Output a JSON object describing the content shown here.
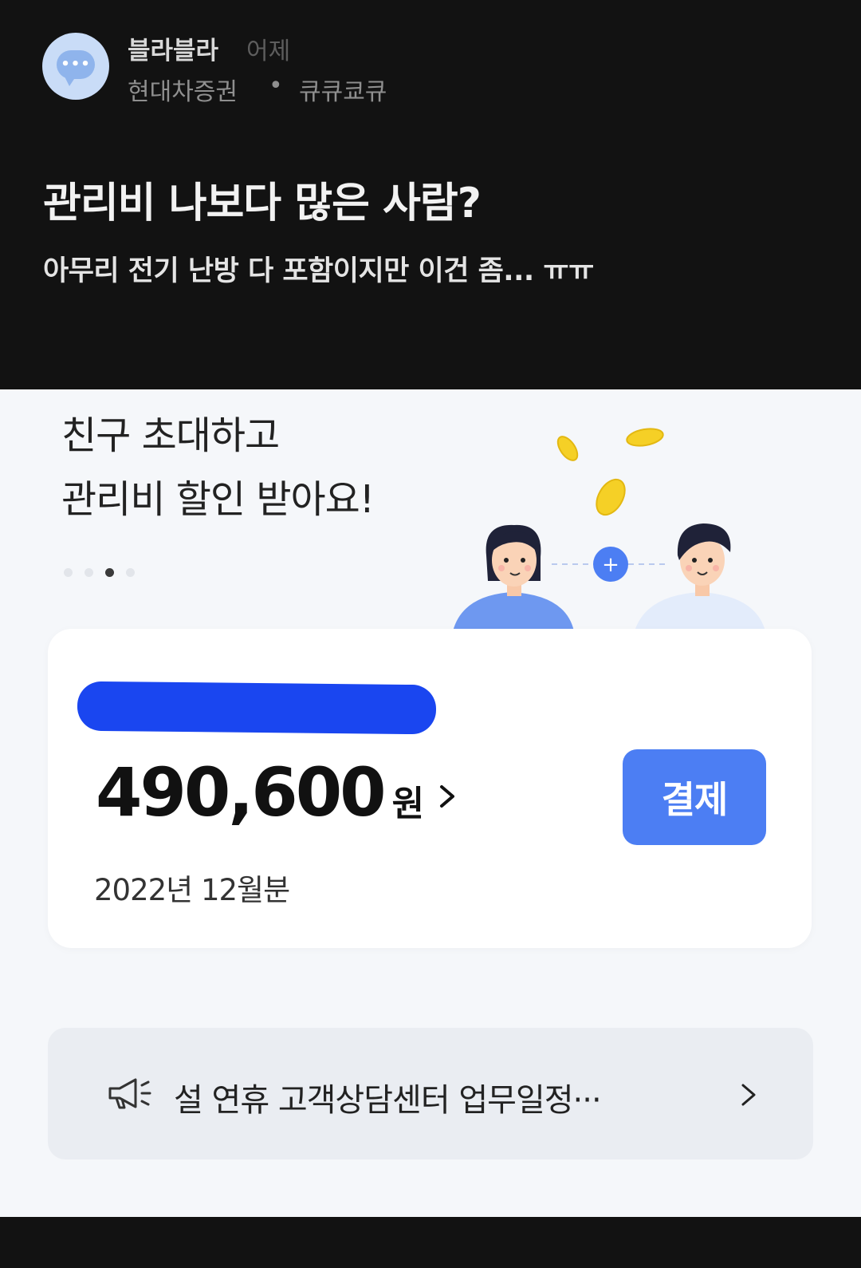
{
  "post": {
    "author": "블라블라",
    "time": "어제",
    "company": "현대차증권",
    "separator": "•",
    "nickname": "큐큐쿄큐",
    "title": "관리비 나보다 많은 사람?",
    "body": "아무리 전기 난방 다 포함이지만 이건 좀... ㅠㅠ"
  },
  "app": {
    "banner": {
      "line1": "친구 초대하고",
      "line2": "관리비 할인 받아요!",
      "plus_glyph": "+",
      "page_count": 4,
      "active_page": 3
    },
    "bill": {
      "amount": "490,600",
      "currency": "원",
      "pay_label": "결제",
      "period": "2022년 12월분"
    },
    "notice": {
      "text": "설 연휴 고객상담센터 업무일정···"
    }
  },
  "colors": {
    "accent_blue": "#4c7ef3",
    "redaction_blue": "#1a46f0",
    "coin_yellow": "#f5d026"
  },
  "icons": [
    "chat-bubble-icon",
    "chevron-right-icon",
    "megaphone-icon",
    "plus-icon"
  ]
}
